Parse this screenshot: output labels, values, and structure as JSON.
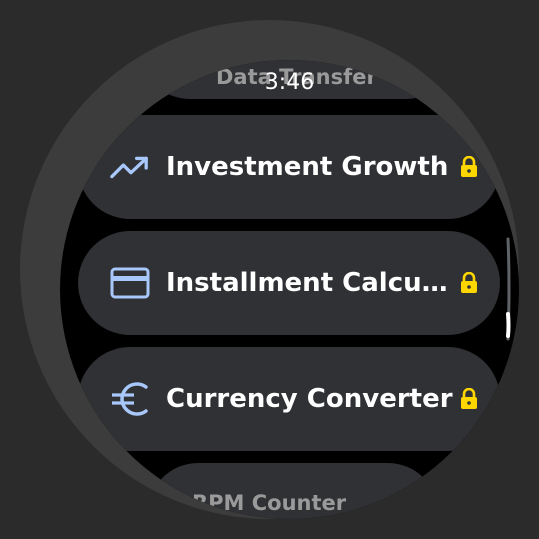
{
  "status": {
    "time": "3:46"
  },
  "list": {
    "items": [
      {
        "label": "Data Transfer",
        "icon": "data-transfer-icon",
        "locked": false
      },
      {
        "label": "Investment Growth",
        "icon": "trending-up-icon",
        "locked": true
      },
      {
        "label": "Installment Calcu…",
        "icon": "credit-card-icon",
        "locked": true
      },
      {
        "label": "Currency Converter",
        "icon": "euro-icon",
        "locked": true
      },
      {
        "label": "RPM Counter",
        "icon": "rpm-icon",
        "locked": false
      }
    ]
  },
  "colors": {
    "background": "#2b2b2b",
    "bezel": "#3c3c3c",
    "screen": "#000000",
    "item": "#303134",
    "icon": "#a8c7fa",
    "lock": "#fdd600",
    "text": "#ffffff",
    "scrollbar": "#ffffff",
    "scrollbar_track": "#5f6368"
  }
}
